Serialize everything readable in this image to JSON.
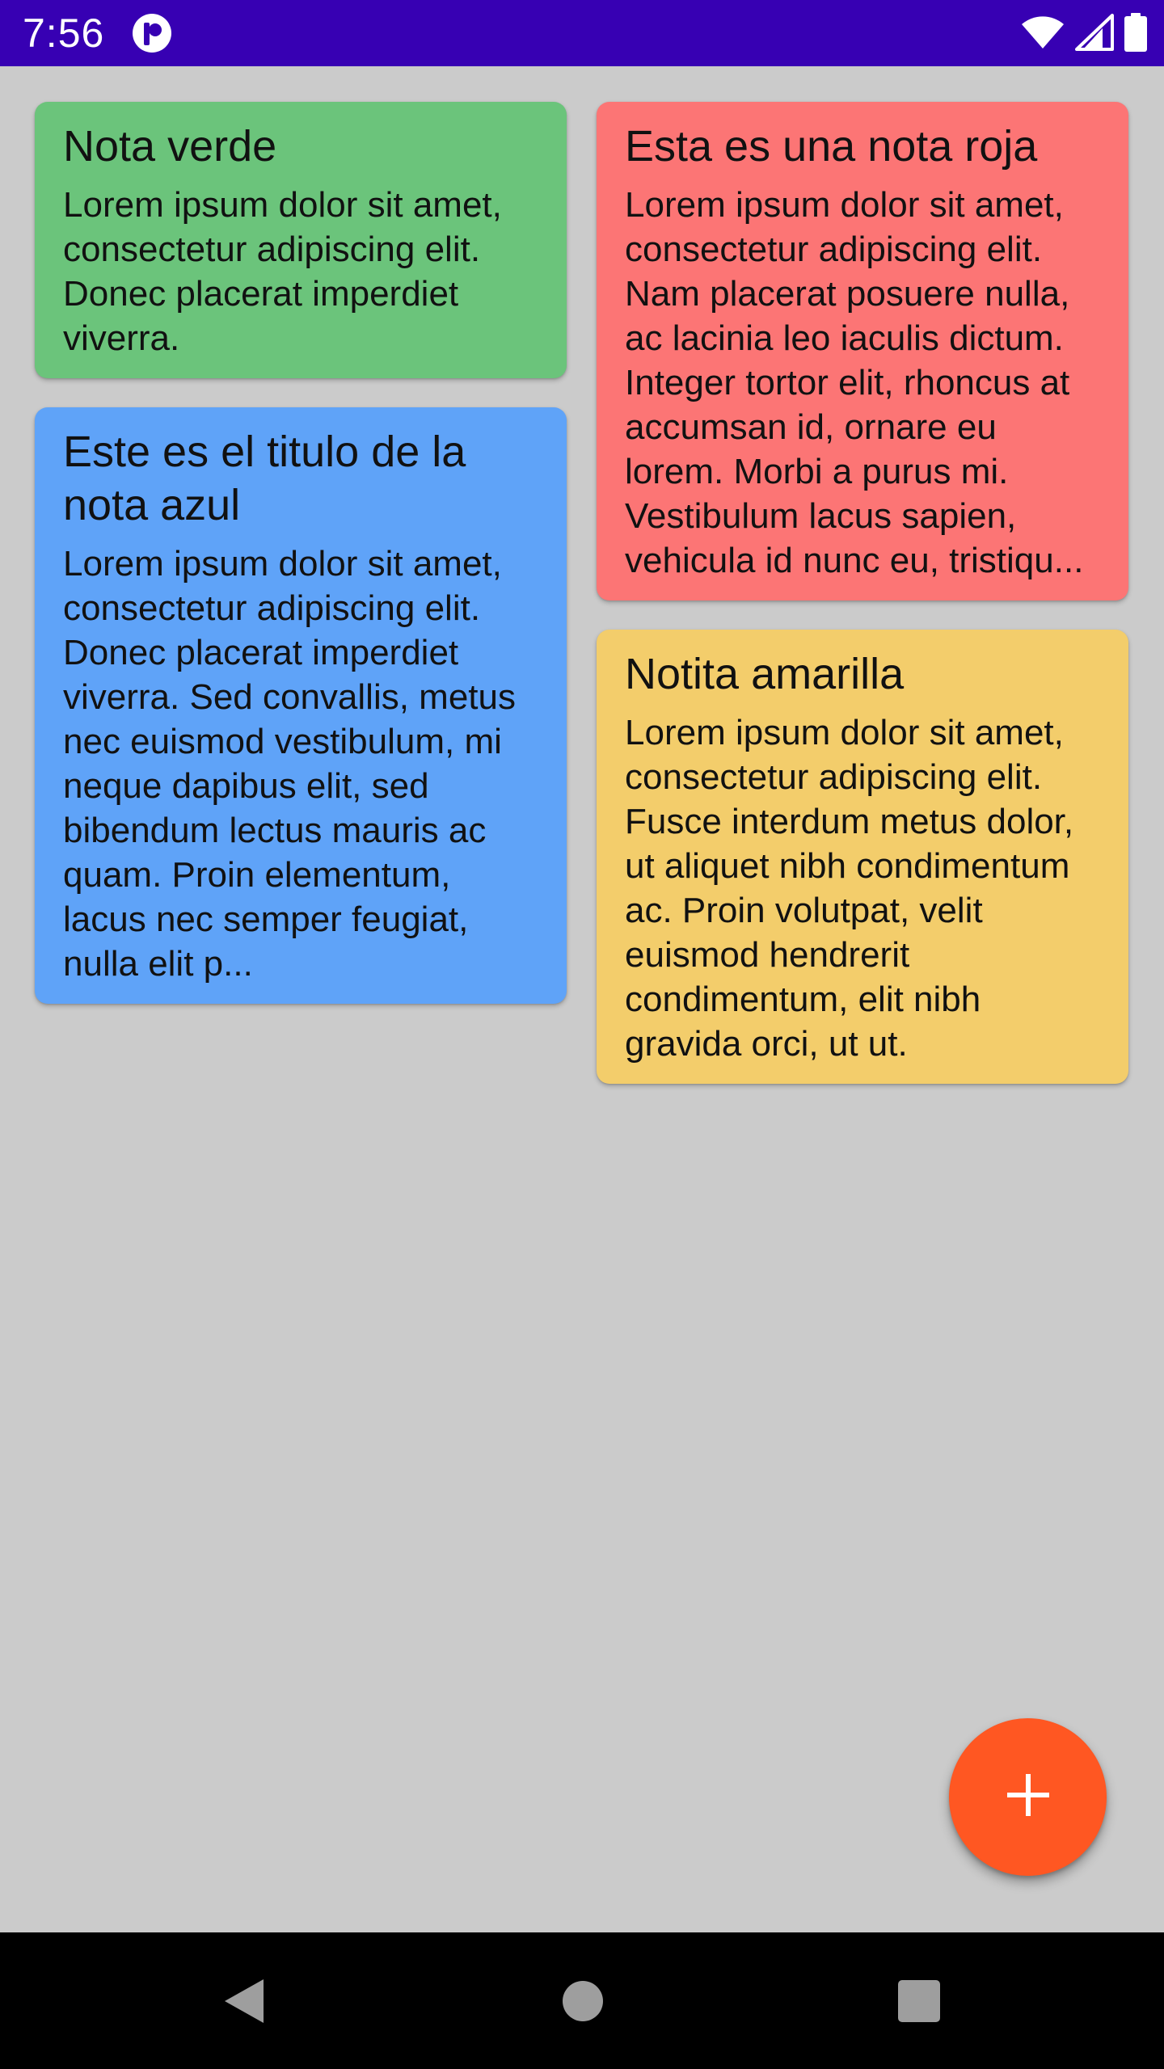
{
  "status_bar": {
    "time": "7:56",
    "background": "#3700b3",
    "app_icon": "notification-app-icon",
    "icons": [
      "wifi-icon",
      "cellular-signal-icon",
      "battery-icon"
    ]
  },
  "notes": {
    "left_column": [
      {
        "title": "Nota verde",
        "body": "Lorem ipsum dolor sit amet, consectetur adipiscing elit. Donec placerat imperdiet viverra.",
        "color": "#6bc47b"
      },
      {
        "title": "Este es el titulo de la nota azul",
        "body": "Lorem ipsum dolor sit amet, consectetur adipiscing elit. Donec placerat imperdiet viverra. Sed convallis, metus nec euismod vestibulum, mi neque dapibus elit, sed bibendum lectus mauris ac quam. Proin elementum, lacus nec semper feugiat, nulla elit p...",
        "color": "#5fa3f8"
      }
    ],
    "right_column": [
      {
        "title": "Esta es una nota roja",
        "body": "Lorem ipsum dolor sit amet, consectetur adipiscing elit. Nam placerat posuere nulla, ac lacinia leo iaculis dictum. Integer tortor elit, rhoncus at accumsan id, ornare eu lorem. Morbi a purus mi. Vestibulum lacus sapien, vehicula id nunc eu, tristiqu...",
        "color": "#fc7575"
      },
      {
        "title": "Notita amarilla",
        "body": "Lorem ipsum dolor sit amet, consectetur adipiscing elit. Fusce interdum metus dolor, ut aliquet nibh condimentum ac. Proin volutpat, velit euismod hendrerit condimentum, elit nibh gravida orci, ut ut.",
        "color": "#f3cd6b"
      }
    ]
  },
  "fab": {
    "icon": "plus-icon",
    "color": "#ff5722"
  },
  "nav_bar": {
    "buttons": [
      "back-icon",
      "home-icon",
      "recents-icon"
    ]
  }
}
